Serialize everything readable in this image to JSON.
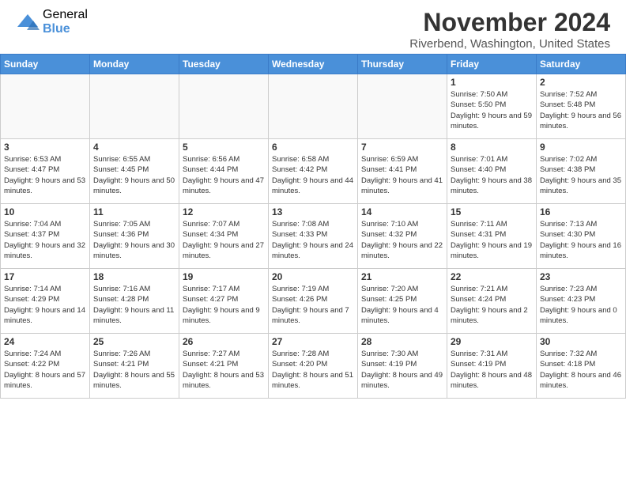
{
  "header": {
    "logo_general": "General",
    "logo_blue": "Blue",
    "month_title": "November 2024",
    "location": "Riverbend, Washington, United States"
  },
  "calendar": {
    "days_of_week": [
      "Sunday",
      "Monday",
      "Tuesday",
      "Wednesday",
      "Thursday",
      "Friday",
      "Saturday"
    ],
    "weeks": [
      [
        {
          "day": "",
          "info": ""
        },
        {
          "day": "",
          "info": ""
        },
        {
          "day": "",
          "info": ""
        },
        {
          "day": "",
          "info": ""
        },
        {
          "day": "",
          "info": ""
        },
        {
          "day": "1",
          "info": "Sunrise: 7:50 AM\nSunset: 5:50 PM\nDaylight: 9 hours and 59 minutes."
        },
        {
          "day": "2",
          "info": "Sunrise: 7:52 AM\nSunset: 5:48 PM\nDaylight: 9 hours and 56 minutes."
        }
      ],
      [
        {
          "day": "3",
          "info": "Sunrise: 6:53 AM\nSunset: 4:47 PM\nDaylight: 9 hours and 53 minutes."
        },
        {
          "day": "4",
          "info": "Sunrise: 6:55 AM\nSunset: 4:45 PM\nDaylight: 9 hours and 50 minutes."
        },
        {
          "day": "5",
          "info": "Sunrise: 6:56 AM\nSunset: 4:44 PM\nDaylight: 9 hours and 47 minutes."
        },
        {
          "day": "6",
          "info": "Sunrise: 6:58 AM\nSunset: 4:42 PM\nDaylight: 9 hours and 44 minutes."
        },
        {
          "day": "7",
          "info": "Sunrise: 6:59 AM\nSunset: 4:41 PM\nDaylight: 9 hours and 41 minutes."
        },
        {
          "day": "8",
          "info": "Sunrise: 7:01 AM\nSunset: 4:40 PM\nDaylight: 9 hours and 38 minutes."
        },
        {
          "day": "9",
          "info": "Sunrise: 7:02 AM\nSunset: 4:38 PM\nDaylight: 9 hours and 35 minutes."
        }
      ],
      [
        {
          "day": "10",
          "info": "Sunrise: 7:04 AM\nSunset: 4:37 PM\nDaylight: 9 hours and 32 minutes."
        },
        {
          "day": "11",
          "info": "Sunrise: 7:05 AM\nSunset: 4:36 PM\nDaylight: 9 hours and 30 minutes."
        },
        {
          "day": "12",
          "info": "Sunrise: 7:07 AM\nSunset: 4:34 PM\nDaylight: 9 hours and 27 minutes."
        },
        {
          "day": "13",
          "info": "Sunrise: 7:08 AM\nSunset: 4:33 PM\nDaylight: 9 hours and 24 minutes."
        },
        {
          "day": "14",
          "info": "Sunrise: 7:10 AM\nSunset: 4:32 PM\nDaylight: 9 hours and 22 minutes."
        },
        {
          "day": "15",
          "info": "Sunrise: 7:11 AM\nSunset: 4:31 PM\nDaylight: 9 hours and 19 minutes."
        },
        {
          "day": "16",
          "info": "Sunrise: 7:13 AM\nSunset: 4:30 PM\nDaylight: 9 hours and 16 minutes."
        }
      ],
      [
        {
          "day": "17",
          "info": "Sunrise: 7:14 AM\nSunset: 4:29 PM\nDaylight: 9 hours and 14 minutes."
        },
        {
          "day": "18",
          "info": "Sunrise: 7:16 AM\nSunset: 4:28 PM\nDaylight: 9 hours and 11 minutes."
        },
        {
          "day": "19",
          "info": "Sunrise: 7:17 AM\nSunset: 4:27 PM\nDaylight: 9 hours and 9 minutes."
        },
        {
          "day": "20",
          "info": "Sunrise: 7:19 AM\nSunset: 4:26 PM\nDaylight: 9 hours and 7 minutes."
        },
        {
          "day": "21",
          "info": "Sunrise: 7:20 AM\nSunset: 4:25 PM\nDaylight: 9 hours and 4 minutes."
        },
        {
          "day": "22",
          "info": "Sunrise: 7:21 AM\nSunset: 4:24 PM\nDaylight: 9 hours and 2 minutes."
        },
        {
          "day": "23",
          "info": "Sunrise: 7:23 AM\nSunset: 4:23 PM\nDaylight: 9 hours and 0 minutes."
        }
      ],
      [
        {
          "day": "24",
          "info": "Sunrise: 7:24 AM\nSunset: 4:22 PM\nDaylight: 8 hours and 57 minutes."
        },
        {
          "day": "25",
          "info": "Sunrise: 7:26 AM\nSunset: 4:21 PM\nDaylight: 8 hours and 55 minutes."
        },
        {
          "day": "26",
          "info": "Sunrise: 7:27 AM\nSunset: 4:21 PM\nDaylight: 8 hours and 53 minutes."
        },
        {
          "day": "27",
          "info": "Sunrise: 7:28 AM\nSunset: 4:20 PM\nDaylight: 8 hours and 51 minutes."
        },
        {
          "day": "28",
          "info": "Sunrise: 7:30 AM\nSunset: 4:19 PM\nDaylight: 8 hours and 49 minutes."
        },
        {
          "day": "29",
          "info": "Sunrise: 7:31 AM\nSunset: 4:19 PM\nDaylight: 8 hours and 48 minutes."
        },
        {
          "day": "30",
          "info": "Sunrise: 7:32 AM\nSunset: 4:18 PM\nDaylight: 8 hours and 46 minutes."
        }
      ]
    ]
  }
}
